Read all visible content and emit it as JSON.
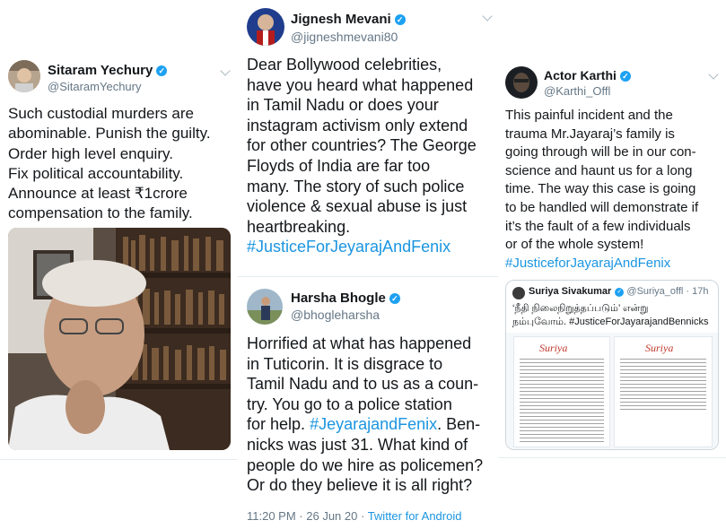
{
  "tweets": {
    "yechury": {
      "name": "Sitaram Yechury",
      "handle": "@SitaramYechury",
      "lines": [
        "Such custodial murders are",
        "abominable. Punish the guilty.",
        "Order high level enquiry.",
        "Fix political accountability.",
        "Announce at least ₹1crore",
        "compensation to the family."
      ]
    },
    "mevani": {
      "name": "Jignesh Mevani",
      "handle": "@jigneshmevani80",
      "lines": [
        "Dear Bollywood celebrities,",
        "have you heard what happened",
        "in Tamil Nadu or does your",
        "instagram activism only extend",
        "for other countries? The George",
        "Floyds of India are far too",
        "many. The story of such police",
        "violence & sexual abuse is just",
        "heartbreaking."
      ],
      "hashtag": "#JusticeForJeyarajAndFenix"
    },
    "bhogle": {
      "name": "Harsha Bhogle",
      "handle": "@bhogleharsha",
      "lines": [
        "Horrified at what has happened",
        "in Tuticorin. It is disgrace to",
        "Tamil Nadu and to us as a coun-",
        "try. You go to a police station",
        "for help."
      ],
      "inline_hashtag": "#JeyarajandFenix",
      "line5_rest": ". Ben-",
      "lines_after": [
        "nicks was just 31. What kind of",
        "people do we hire as policemen?",
        "Or do they believe it is all right?"
      ],
      "time": "11:20 PM",
      "date": "26 Jun 20",
      "source": "Twitter for Android"
    },
    "karthi": {
      "name": "Actor Karthi",
      "handle": "@Karthi_Offl",
      "lines": [
        "This painful incident and the",
        "trauma Mr.Jayaraj’s family is",
        "going through will be in our con-",
        "science and haunt us for a long",
        "time. The way this case is going",
        "to be handled will demonstrate if",
        "it’s the fault of a few individuals",
        "or of the whole system!"
      ],
      "hashtag": "#JusticeforJayarajAndFenix",
      "quoted": {
        "name": "Suriya Sivakumar",
        "handle": "@Suriya_offl",
        "age": "17h",
        "line1": "‘நீதி நிலைநிறுத்தப்படும்’ என்று",
        "line2_prefix": "நம்புவோம்.",
        "hashtag": "#JusticeForJayarajandBennicks",
        "letter_signature": "Suriya"
      }
    }
  },
  "icons": {
    "verified": "verified-badge-icon",
    "more": "chevron-down-icon"
  },
  "colors": {
    "link": "#1b95e0",
    "verified": "#1da1f2",
    "muted": "#657786"
  }
}
